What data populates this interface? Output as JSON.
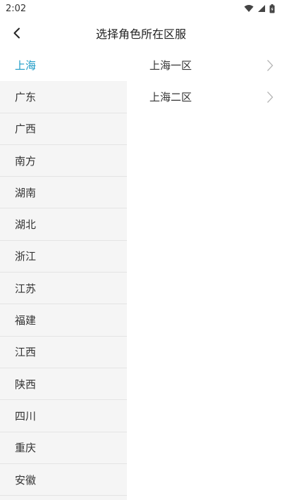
{
  "status_bar": {
    "time": "2:02",
    "icons": [
      "wifi-icon",
      "signal-icon",
      "battery-icon"
    ]
  },
  "header": {
    "title": "选择角色所在区服",
    "back_icon": "chevron-left-icon"
  },
  "colors": {
    "accent": "#1b9ac6",
    "sidebar_bg": "#f5f5f5",
    "divider": "#e4e4e4"
  },
  "regions": [
    {
      "label": "上海",
      "active": true
    },
    {
      "label": "广东",
      "active": false
    },
    {
      "label": "广西",
      "active": false
    },
    {
      "label": "南方",
      "active": false
    },
    {
      "label": "湖南",
      "active": false
    },
    {
      "label": "湖北",
      "active": false
    },
    {
      "label": "浙江",
      "active": false
    },
    {
      "label": "江苏",
      "active": false
    },
    {
      "label": "福建",
      "active": false
    },
    {
      "label": "江西",
      "active": false
    },
    {
      "label": "陕西",
      "active": false
    },
    {
      "label": "四川",
      "active": false
    },
    {
      "label": "重庆",
      "active": false
    },
    {
      "label": "安徽",
      "active": false
    }
  ],
  "servers": [
    {
      "label": "上海一区"
    },
    {
      "label": "上海二区"
    }
  ]
}
